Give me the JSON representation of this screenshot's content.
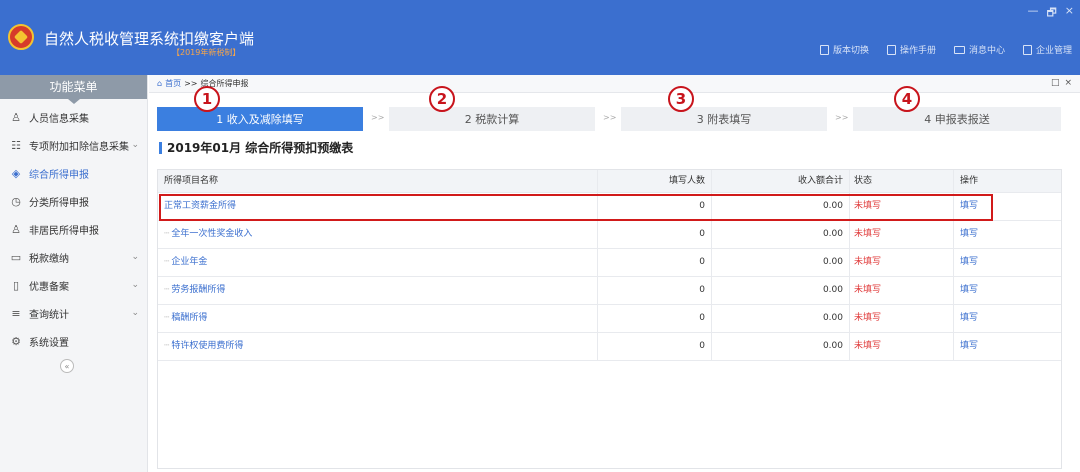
{
  "header": {
    "title": "自然人税收管理系统扣缴客户端",
    "subtitle": "【2019年新税制】",
    "window_controls": [
      "—",
      "🗗",
      "×"
    ],
    "links": [
      {
        "label": "版本切换",
        "icon": "document-icon"
      },
      {
        "label": "操作手册",
        "icon": "manual-icon"
      },
      {
        "label": "消息中心",
        "icon": "mail-icon"
      },
      {
        "label": "企业管理",
        "icon": "building-icon"
      }
    ]
  },
  "sidebar": {
    "title": "功能菜单",
    "items": [
      {
        "label": "人员信息采集",
        "icon": "person-icon",
        "glyph": "♙",
        "chevron": "",
        "active": false
      },
      {
        "label": "专项附加扣除信息采集",
        "icon": "list-icon",
        "glyph": "☷",
        "chevron": "⌄",
        "active": false
      },
      {
        "label": "综合所得申报",
        "icon": "layers-icon",
        "glyph": "◈",
        "chevron": "",
        "active": true
      },
      {
        "label": "分类所得申报",
        "icon": "clock-icon",
        "glyph": "◷",
        "chevron": "",
        "active": false
      },
      {
        "label": "非居民所得申报",
        "icon": "user-icon",
        "glyph": "♙",
        "chevron": "",
        "active": false
      },
      {
        "label": "税款缴纳",
        "icon": "folder-icon",
        "glyph": "▭",
        "chevron": "⌄",
        "active": false
      },
      {
        "label": "优惠备案",
        "icon": "doc-icon",
        "glyph": "▯",
        "chevron": "⌄",
        "active": false
      },
      {
        "label": "查询统计",
        "icon": "query-icon",
        "glyph": "≡",
        "chevron": "⌄",
        "active": false
      },
      {
        "label": "系统设置",
        "icon": "gear-icon",
        "glyph": "⚙",
        "chevron": "",
        "active": false
      }
    ],
    "collapse_glyph": "«"
  },
  "breadcrumb": {
    "home_icon": "⌂",
    "home": "首页",
    "sep": ">>",
    "current": "综合所得申报",
    "controls": [
      "□",
      "×"
    ]
  },
  "steps": [
    {
      "label": "1 收入及减除填写",
      "num": "1",
      "active": true
    },
    {
      "label": "2 税款计算",
      "num": "2",
      "active": false
    },
    {
      "label": "3 附表填写",
      "num": "3",
      "active": false
    },
    {
      "label": "4 申报表报送",
      "num": "4",
      "active": false
    }
  ],
  "step_sep": ">>",
  "section_title": "2019年01月  综合所得预扣预缴表",
  "table": {
    "headers": {
      "name": "所得项目名称",
      "count": "填写人数",
      "amount": "收入额合计",
      "status": "状态",
      "op": "操作"
    },
    "rows": [
      {
        "name": "正常工资薪金所得",
        "count": "0",
        "amount": "0.00",
        "status": "未填写",
        "op": "填写"
      },
      {
        "name": "全年一次性奖金收入",
        "count": "0",
        "amount": "0.00",
        "status": "未填写",
        "op": "填写"
      },
      {
        "name": "企业年金",
        "count": "0",
        "amount": "0.00",
        "status": "未填写",
        "op": "填写"
      },
      {
        "name": "劳务报酬所得",
        "count": "0",
        "amount": "0.00",
        "status": "未填写",
        "op": "填写"
      },
      {
        "name": "稿酬所得",
        "count": "0",
        "amount": "0.00",
        "status": "未填写",
        "op": "填写"
      },
      {
        "name": "特许权使用费所得",
        "count": "0",
        "amount": "0.00",
        "status": "未填写",
        "op": "填写"
      }
    ]
  },
  "colors": {
    "header_bg": "#3b6fcf",
    "accent": "#3b7fe0",
    "status_red": "#e03b3b",
    "annotation_red": "#c8141c"
  }
}
